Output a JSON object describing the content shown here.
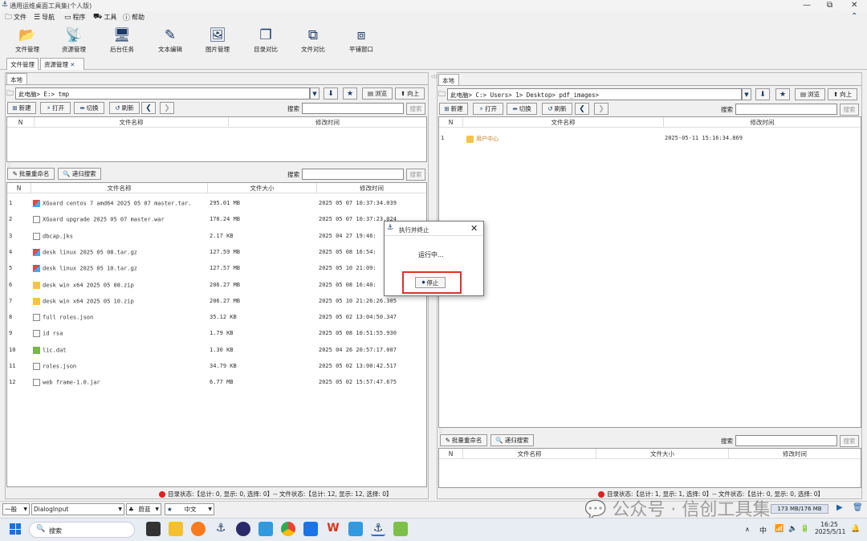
{
  "window": {
    "title": "通用运维桌面工具集(个人版)",
    "controls": [
      "—",
      "⧉",
      "✕",
      "⌃"
    ]
  },
  "menu": [
    {
      "label": "文件",
      "icon": "folder-icon"
    },
    {
      "label": "导航",
      "icon": "list-icon"
    },
    {
      "label": "程序",
      "icon": "program-icon"
    },
    {
      "label": "工具",
      "icon": "toolbox-icon"
    },
    {
      "label": "帮助",
      "icon": "help-icon"
    }
  ],
  "toolbar": [
    {
      "label": "文件管理",
      "glyph": "📂"
    },
    {
      "label": "资源管理",
      "glyph": "📡"
    },
    {
      "label": "后台任务",
      "glyph": "🖥"
    },
    {
      "label": "文本编辑",
      "glyph": "✎"
    },
    {
      "label": "图片管理",
      "glyph": "🖼"
    },
    {
      "label": "目录对比",
      "glyph": "❐"
    },
    {
      "label": "文件对比",
      "glyph": "⧉"
    },
    {
      "label": "平铺窗口",
      "glyph": "⧈"
    }
  ],
  "tabs": [
    {
      "label": "文件管理"
    },
    {
      "label": "资源管理",
      "close": "✕"
    }
  ],
  "left": {
    "subtab": "本地",
    "address": "此电脑> E:> tmp",
    "browse": "浏览",
    "up": "向上",
    "actions": {
      "new": "新建",
      "open": "打开",
      "switch": "切换",
      "refresh": "刷新"
    },
    "search_label": "搜索",
    "search_btn": "搜索",
    "folder_header": {
      "n": "N",
      "name": "文件名称",
      "mtime": "修改时间"
    },
    "batch_rename": "批量重命名",
    "recursive_search": "递归搜索",
    "search_label2": "搜索",
    "search_btn2": "搜索",
    "file_header": {
      "n": "N",
      "name": "文件名称",
      "size": "文件大小",
      "mtime": "修改时间"
    },
    "files": [
      {
        "n": "1",
        "name": "XGuard centos 7 amd64 2025 05 07 master.tar.",
        "size": "295.01 MB",
        "mtime": "2025 05 07 10:37:34.039",
        "icon": "archive"
      },
      {
        "n": "2",
        "name": "XGuard upgrade 2025 05 07 master.war",
        "size": "170.24 MB",
        "mtime": "2025 05 07 10:37:23.024",
        "icon": "file"
      },
      {
        "n": "3",
        "name": "dbcap.jks",
        "size": "2.17 KB",
        "mtime": "2025 04 27 19:46:",
        "icon": "file"
      },
      {
        "n": "4",
        "name": "desk linux 2025 05 08.tar.gz",
        "size": "127.59 MB",
        "mtime": "2025 05 08 16:54:",
        "icon": "archive"
      },
      {
        "n": "5",
        "name": "desk linux 2025 05 10.tar.gz",
        "size": "127.57 MB",
        "mtime": "2025 05 10 21:09:",
        "icon": "archive"
      },
      {
        "n": "6",
        "name": "desk win x64 2025 05 08.zip",
        "size": "206.27 MB",
        "mtime": "2025 05 08 16:40:",
        "icon": "zip"
      },
      {
        "n": "7",
        "name": "desk win x64 2025 05 10.zip",
        "size": "206.27 MB",
        "mtime": "2025 05 10 21:26:26.305",
        "icon": "zip"
      },
      {
        "n": "8",
        "name": "full roles.json",
        "size": "35.12 KB",
        "mtime": "2025 05 02 13:04:50.347",
        "icon": "doc"
      },
      {
        "n": "9",
        "name": "id rsa",
        "size": "1.79 KB",
        "mtime": "2025 05 08 10:51:55.930",
        "icon": "doc"
      },
      {
        "n": "10",
        "name": "lic.dat",
        "size": "1.30 KB",
        "mtime": "2025 04 26 20:57:17.007",
        "icon": "dat"
      },
      {
        "n": "11",
        "name": "roles.json",
        "size": "34.79 KB",
        "mtime": "2025 05 02 13:00:42.517",
        "icon": "doc"
      },
      {
        "n": "12",
        "name": "web frame-1.0.jar",
        "size": "6.77 MB",
        "mtime": "2025 05 02 15:57:47.675",
        "icon": "file"
      }
    ],
    "status": "目录状态:【总计: 0, 显示: 0, 选择: 0】-- 文件状态:【总计: 12, 显示: 12, 选择: 0】"
  },
  "right": {
    "subtab": "本地",
    "address": "此电脑> C:> Users> 1> Desktop> pdf_images>",
    "browse": "浏览",
    "up": "向上",
    "actions": {
      "new": "新建",
      "open": "打开",
      "switch": "切换",
      "refresh": "刷新"
    },
    "search_label": "搜索",
    "search_btn": "搜索",
    "folder_header": {
      "n": "N",
      "name": "文件名称",
      "mtime": "修改时间"
    },
    "folders": [
      {
        "n": "1",
        "name": "用户中心",
        "mtime": "2025-05-11 15:16:34.869"
      }
    ],
    "batch_rename": "批量重命名",
    "recursive_search": "递归搜索",
    "search_label2": "搜索",
    "search_btn2": "搜索",
    "file_header": {
      "n": "N",
      "name": "文件名称",
      "size": "文件大小",
      "mtime": "修改时间"
    },
    "status": "目录状态:【总计: 1, 显示: 1, 选择: 0】-- 文件状态:【总计: 0, 显示: 0, 选择: 0】"
  },
  "dialog": {
    "title": "执行并终止",
    "message": "运行中...",
    "stop": "停止",
    "close": "✕"
  },
  "bottom": {
    "level": "一般",
    "component": "DialogInput",
    "theme": "蔚蓝",
    "lang": "中文",
    "mem": "173 MB/176 MB"
  },
  "watermark": "公众号 · 信创工具集",
  "taskbar": {
    "search": "搜索",
    "ime": "中",
    "time": "16:25",
    "date": "2025/5/11"
  }
}
